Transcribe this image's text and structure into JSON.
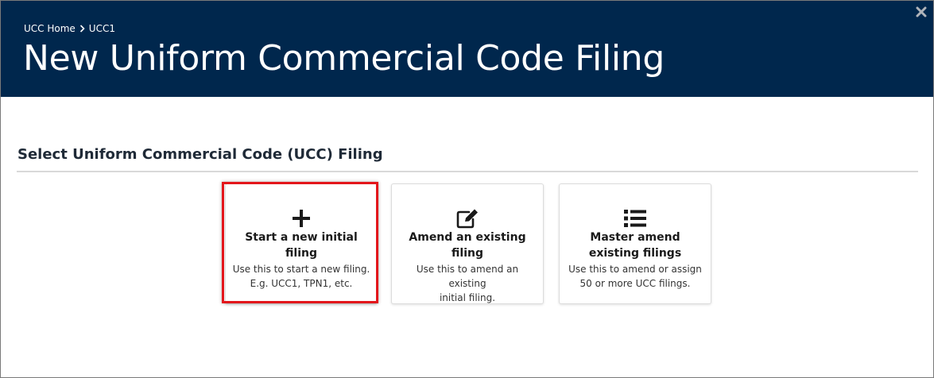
{
  "breadcrumb": {
    "home": "UCC Home",
    "current": "UCC1"
  },
  "header": {
    "title": "New Uniform Commercial Code Filing",
    "background_color": "#00274d"
  },
  "section": {
    "title": "Select Uniform Commercial Code (UCC) Filing"
  },
  "options": [
    {
      "icon": "plus-icon",
      "title_line1": "Start a new initial",
      "title_line2": "filing",
      "desc_line1": "Use this to start a new filing.",
      "desc_line2": "E.g. UCC1, TPN1, etc."
    },
    {
      "icon": "edit-icon",
      "title_line1": "Amend an existing",
      "title_line2": "filing",
      "desc_line1": "Use this to amend an existing",
      "desc_line2": "initial filing."
    },
    {
      "icon": "list-icon",
      "title_line1": "Master amend",
      "title_line2": "existing filings",
      "desc_line1": "Use this to amend or assign",
      "desc_line2": "50 or more UCC filings."
    }
  ],
  "highlight_color": "#e3161b"
}
